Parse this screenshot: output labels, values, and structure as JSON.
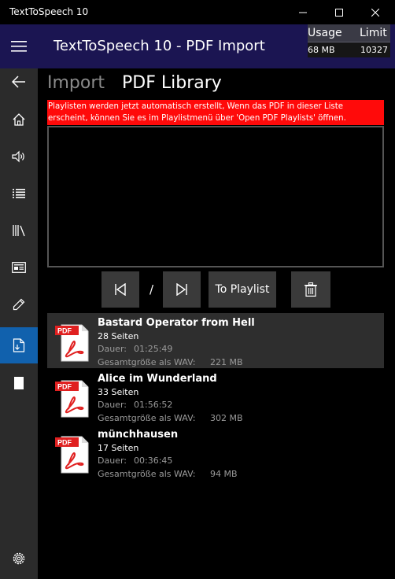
{
  "window": {
    "title": "TextToSpeech 10"
  },
  "header": {
    "title": "TextToSpeech 10 - PDF Import",
    "usage_label": "Usage",
    "limit_label": "Limit",
    "usage_value": "68 MB",
    "limit_value": "10327"
  },
  "tabs": {
    "import": "Import",
    "library": "PDF Library"
  },
  "banner": "Playlisten werden jetzt automatisch erstellt, Wenn das PDF in dieser Liste erscheint, können Sie es im Playlistmenü über 'Open PDF Playlists' öffnen.",
  "controls": {
    "slash": "/",
    "to_playlist": "To Playlist"
  },
  "labels": {
    "duration": "Dauer:",
    "size": "Gesamtgröße als WAV:",
    "pdf_badge": "PDF"
  },
  "pdfs": [
    {
      "name": "Bastard Operator from Hell",
      "pages": "28 Seiten",
      "duration": "01:25:49",
      "size": "221  MB"
    },
    {
      "name": "Alice im Wunderland",
      "pages": "33 Seiten",
      "duration": "01:56:52",
      "size": "302  MB"
    },
    {
      "name": "münchhausen",
      "pages": "17 Seiten",
      "duration": "00:36:45",
      "size": "94  MB"
    }
  ],
  "sidebar_icons": [
    "back-arrow-icon",
    "home-icon",
    "speaker-icon",
    "list-icon",
    "library-icon",
    "newspaper-icon",
    "pencil-icon",
    "pdf-import-icon",
    "document-icon",
    "settings-icon"
  ],
  "colors": {
    "header_bg": "#1b1552",
    "active_item": "#1161ad",
    "banner_bg": "#ff0a0a",
    "pdf_red": "#e02020"
  }
}
